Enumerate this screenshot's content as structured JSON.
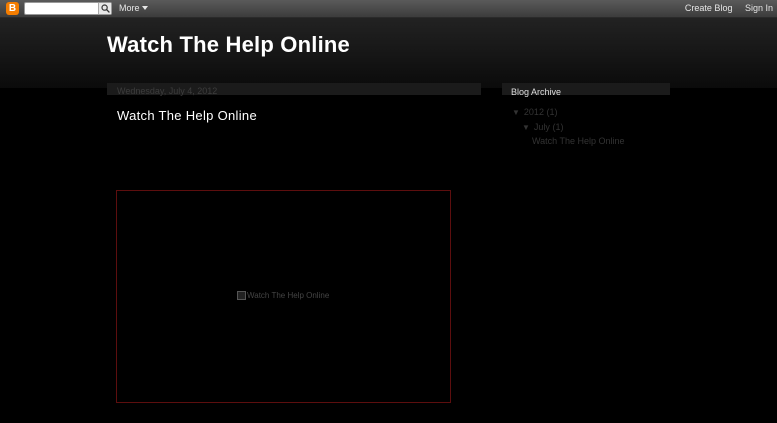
{
  "navbar": {
    "logo_letter": "B",
    "search_value": "",
    "more_label": "More",
    "create_blog_label": "Create Blog",
    "sign_in_label": "Sign In"
  },
  "header": {
    "blog_title": "Watch The Help Online"
  },
  "post": {
    "date": "Wednesday, July 4, 2012",
    "title": "Watch The Help Online",
    "image_alt": "Watch The Help Online"
  },
  "sidebar": {
    "title": "Blog Archive",
    "year_label": "2012",
    "year_count": "(1)",
    "month_label": "July",
    "month_count": "(1)",
    "post_link": "Watch The Help Online",
    "toggle_glyph": "▼"
  },
  "colors": {
    "background": "#000000",
    "navbar": "#4a4a4a",
    "logo": "#f57d00",
    "image_border": "#5d0e0e"
  }
}
